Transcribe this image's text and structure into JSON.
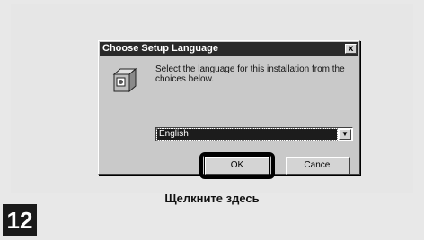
{
  "dialog": {
    "title": "Choose Setup Language",
    "close_glyph": "x",
    "message": "Select the language for this installation from the choices below.",
    "language_select": {
      "selected": "English",
      "arrow_glyph": "▼"
    },
    "ok_label": "OK",
    "cancel_label": "Cancel"
  },
  "caption": "Щелкните здесь",
  "step_number": "12",
  "icons": {
    "setup": "setup-box-icon",
    "close": "close-icon",
    "dropdown": "chevron-down-icon"
  }
}
